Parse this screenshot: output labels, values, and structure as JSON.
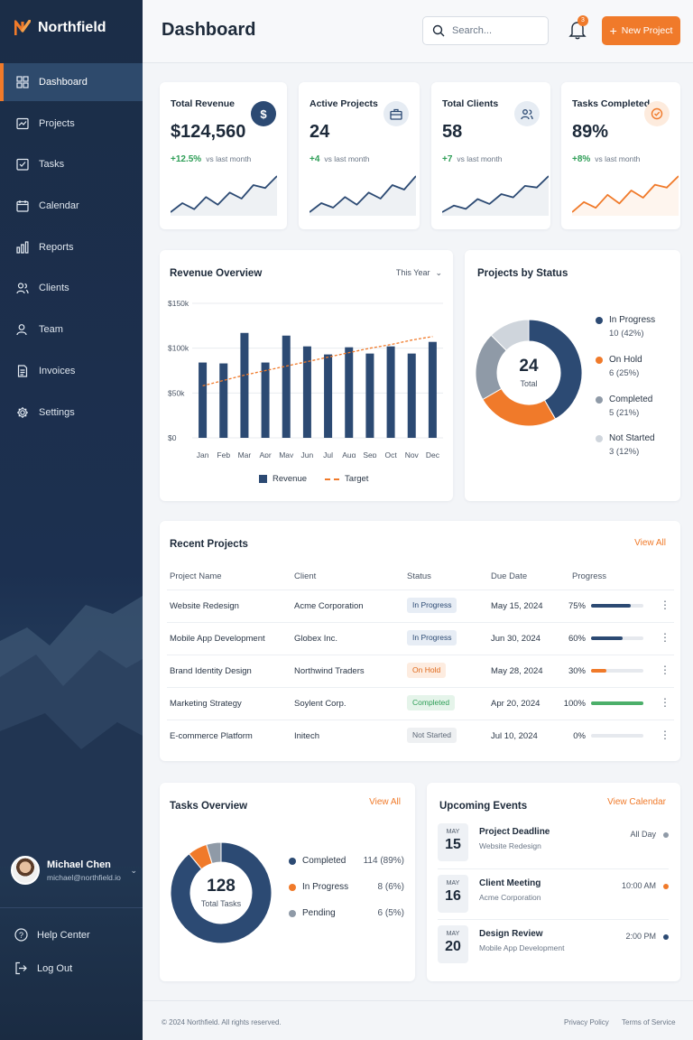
{
  "colors": {
    "navy": "#2c4a73",
    "orange": "#f07a2a",
    "green": "#4caf6a",
    "gray": "#8f9aa7",
    "light_gray": "#cfd5dc"
  },
  "sidebar": {
    "brand": "Northfield",
    "items": [
      {
        "label": "Dashboard",
        "icon": "grid-icon",
        "active": true
      },
      {
        "label": "Projects",
        "icon": "chart-box-icon"
      },
      {
        "label": "Tasks",
        "icon": "checkbox-icon"
      },
      {
        "label": "Calendar",
        "icon": "calendar-icon"
      },
      {
        "label": "Reports",
        "icon": "bar-chart-icon"
      },
      {
        "label": "Clients",
        "icon": "users-icon"
      },
      {
        "label": "Team",
        "icon": "team-icon"
      },
      {
        "label": "Invoices",
        "icon": "document-icon"
      },
      {
        "label": "Settings",
        "icon": "gear-icon"
      }
    ],
    "user": {
      "name": "Michael Chen",
      "email": "michael@northfield.io"
    },
    "help": "Help Center",
    "logout": "Log Out"
  },
  "header": {
    "title": "Dashboard",
    "search_placeholder": "Search...",
    "notifications_count": "3",
    "new_project_label": "New Project"
  },
  "kpis": [
    {
      "title": "Total Revenue",
      "value": "$124,560",
      "delta": "+12.5%",
      "note": "vs last month",
      "icon": "dollar-icon",
      "spark": [
        12,
        18,
        14,
        22,
        17,
        25,
        21,
        30,
        28,
        36
      ],
      "color": "#2c4a73"
    },
    {
      "title": "Active Projects",
      "value": "24",
      "delta": "+4",
      "note": "vs last month",
      "icon": "briefcase-icon",
      "spark": [
        10,
        16,
        13,
        20,
        15,
        23,
        19,
        28,
        25,
        34
      ],
      "color": "#2c4a73"
    },
    {
      "title": "Total Clients",
      "value": "58",
      "delta": "+7",
      "note": "vs last month",
      "icon": "users-icon",
      "spark": [
        11,
        15,
        13,
        19,
        16,
        22,
        20,
        27,
        26,
        33
      ],
      "color": "#2c4a73"
    },
    {
      "title": "Tasks Completed",
      "value": "89%",
      "delta": "+8%",
      "note": "vs last month",
      "icon": "check-circle-icon",
      "spark": [
        10,
        17,
        13,
        22,
        16,
        25,
        20,
        29,
        27,
        35
      ],
      "color": "#f07a2a"
    }
  ],
  "revenue": {
    "title": "Revenue Overview",
    "filter": "This Year",
    "legend_revenue": "Revenue",
    "legend_target": "Target"
  },
  "status": {
    "title": "Projects by Status",
    "total": "24",
    "total_label": "Total",
    "items": [
      {
        "name": "In Progress",
        "detail": "10 (42%)",
        "value": 10,
        "color": "#2c4a73"
      },
      {
        "name": "On Hold",
        "detail": "6 (25%)",
        "value": 6,
        "color": "#f07a2a"
      },
      {
        "name": "Completed",
        "detail": "5 (21%)",
        "value": 5,
        "color": "#8f9aa7"
      },
      {
        "name": "Not Started",
        "detail": "3 (12%)",
        "value": 3,
        "color": "#cfd5dc"
      }
    ]
  },
  "projects": {
    "title": "Recent Projects",
    "view_all": "View All",
    "columns": [
      "Project Name",
      "Client",
      "Status",
      "Due Date",
      "Progress"
    ],
    "rows": [
      {
        "name": "Website Redesign",
        "client": "Acme Corporation",
        "status": "In Progress",
        "due": "May 15, 2024",
        "progress": "75%",
        "fill": 0.75,
        "color": "#2c4a73"
      },
      {
        "name": "Mobile App Development",
        "client": "Globex Inc.",
        "status": "In Progress",
        "due": "Jun 30, 2024",
        "progress": "60%",
        "fill": 0.6,
        "color": "#2c4a73"
      },
      {
        "name": "Brand Identity Design",
        "client": "Northwind Traders",
        "status": "On Hold",
        "due": "May 28, 2024",
        "progress": "30%",
        "fill": 0.3,
        "color": "#f07a2a"
      },
      {
        "name": "Marketing Strategy",
        "client": "Soylent Corp.",
        "status": "Completed",
        "due": "Apr 20, 2024",
        "progress": "100%",
        "fill": 1.0,
        "color": "#4caf6a"
      },
      {
        "name": "E-commerce Platform",
        "client": "Initech",
        "status": "Not Started",
        "due": "Jul 10, 2024",
        "progress": "0%",
        "fill": 0,
        "color": "#8f9aa7"
      }
    ]
  },
  "tasks": {
    "title": "Tasks Overview",
    "view_all": "View All",
    "total": "128",
    "total_label": "Total Tasks",
    "items": [
      {
        "name": "Completed",
        "detail": "114 (89%)",
        "value": 114,
        "color": "#2c4a73"
      },
      {
        "name": "In Progress",
        "detail": "8 (6%)",
        "value": 8,
        "color": "#f07a2a"
      },
      {
        "name": "Pending",
        "detail": "6 (5%)",
        "value": 6,
        "color": "#8f9aa7"
      }
    ]
  },
  "events": {
    "title": "Upcoming Events",
    "view_calendar": "View Calendar",
    "items": [
      {
        "month": "MAY",
        "day": "15",
        "title": "Project Deadline",
        "sub": "Website Redesign",
        "time": "All Day",
        "color": "#8f9aa7"
      },
      {
        "month": "MAY",
        "day": "16",
        "title": "Client Meeting",
        "sub": "Acme Corporation",
        "time": "10:00 AM",
        "color": "#f07a2a"
      },
      {
        "month": "MAY",
        "day": "20",
        "title": "Design Review",
        "sub": "Mobile App Development",
        "time": "2:00 PM",
        "color": "#2c4a73"
      }
    ]
  },
  "footer": {
    "copyright": "© 2024 Northfield. All rights reserved.",
    "privacy": "Privacy Policy",
    "terms": "Terms of Service"
  },
  "chart_data": {
    "type": "bar",
    "categories": [
      "Jan",
      "Feb",
      "Mar",
      "Apr",
      "May",
      "Jun",
      "Jul",
      "Aug",
      "Sep",
      "Oct",
      "Nov",
      "Dec"
    ],
    "series": [
      {
        "name": "Revenue",
        "values": [
          84,
          83,
          117,
          84,
          114,
          102,
          93,
          101,
          94,
          102,
          94,
          107
        ]
      },
      {
        "name": "Target",
        "values": [
          58,
          64,
          70,
          75,
          80,
          85,
          90,
          95,
          100,
          104,
          109,
          113
        ]
      }
    ],
    "ytick_labels": [
      "$0",
      "$50k",
      "$100k",
      "$150k"
    ],
    "ylim": [
      0,
      150
    ],
    "grid": true,
    "legend": "bottom"
  }
}
